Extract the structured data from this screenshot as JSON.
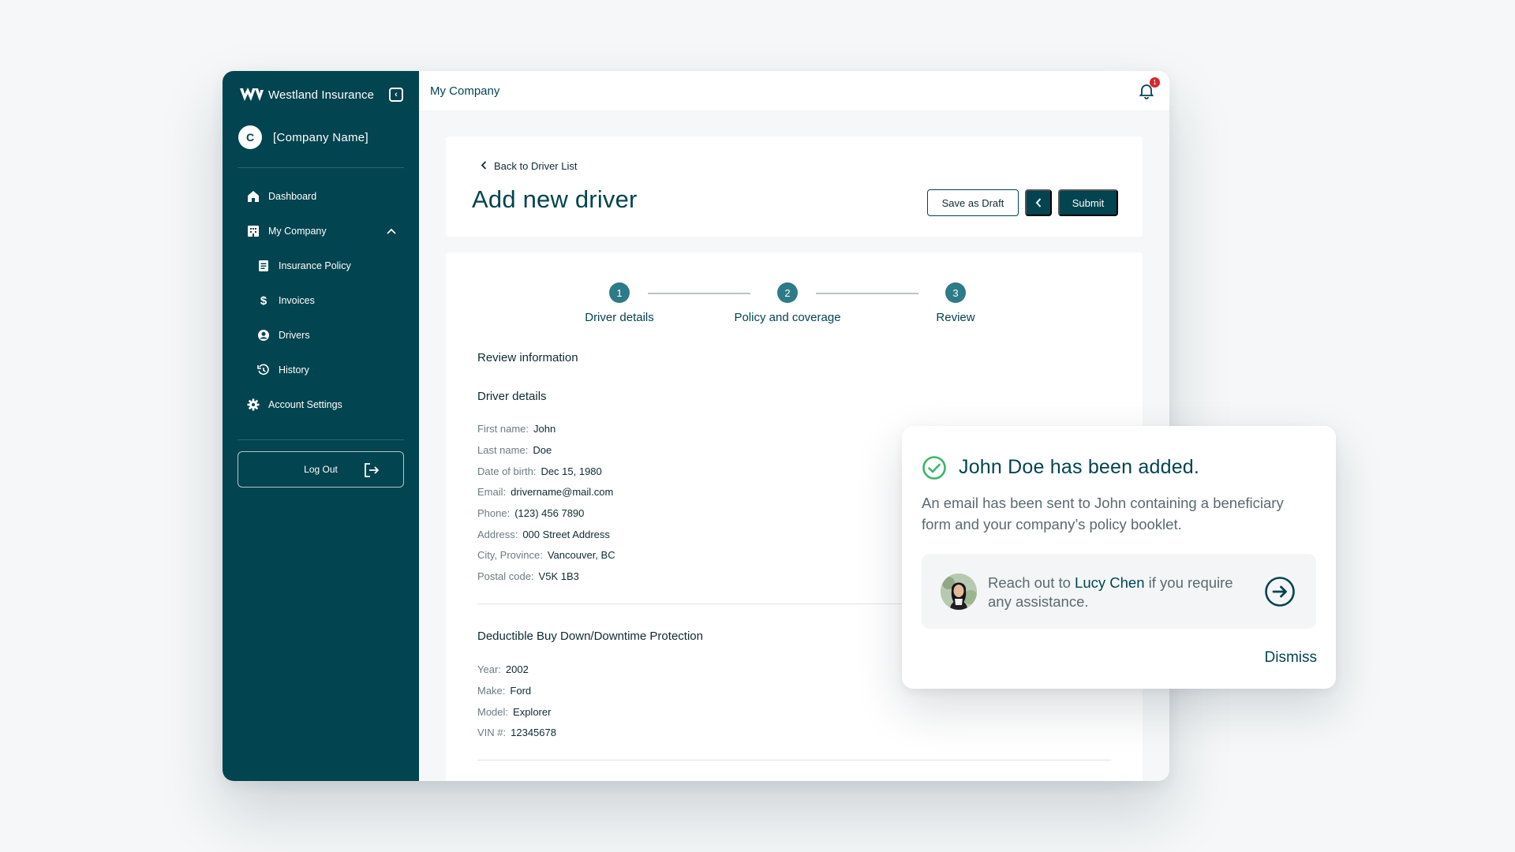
{
  "brand": {
    "name": "Westland Insurance",
    "initial": "W"
  },
  "company": {
    "avatar_letter": "C",
    "name": "[Company Name]"
  },
  "sidebar": {
    "items": [
      {
        "label": "Dashboard"
      },
      {
        "label": "My Company"
      },
      {
        "label": "Insurance Policy"
      },
      {
        "label": "Invoices"
      },
      {
        "label": "Drivers"
      },
      {
        "label": "History"
      },
      {
        "label": "Account Settings"
      }
    ],
    "logout_label": "Log Out"
  },
  "topbar": {
    "title": "My Company",
    "notification_count": "1"
  },
  "header": {
    "back_label": "Back to Driver List",
    "title": "Add new driver",
    "save_draft_label": "Save as Draft",
    "submit_label": "Submit"
  },
  "stepper": {
    "steps": [
      {
        "number": "1",
        "label": "Driver details"
      },
      {
        "number": "2",
        "label": "Policy and coverage"
      },
      {
        "number": "3",
        "label": "Review"
      }
    ]
  },
  "review": {
    "title": "Review information",
    "driver": {
      "title": "Driver details",
      "fields": [
        {
          "key": "First name:",
          "value": "John"
        },
        {
          "key": "Last name:",
          "value": "Doe"
        },
        {
          "key": "Date of birth:",
          "value": "Dec 15, 1980"
        },
        {
          "key": "Email:",
          "value": "drivername@mail.com"
        },
        {
          "key": "Phone:",
          "value": "(123) 456 7890"
        },
        {
          "key": "Address:",
          "value": "000 Street Address"
        },
        {
          "key": "City, Province:",
          "value": "Vancouver, BC"
        },
        {
          "key": "Postal code:",
          "value": "V5K 1B3"
        }
      ]
    },
    "vehicle": {
      "title": "Deductible Buy Down/Downtime Protection",
      "fields": [
        {
          "key": "Year:",
          "value": "2002"
        },
        {
          "key": "Make:",
          "value": "Ford"
        },
        {
          "key": "Model:",
          "value": "Explorer"
        },
        {
          "key": "VIN #:",
          "value": "12345678"
        }
      ]
    }
  },
  "toast": {
    "title": "John Doe has been added.",
    "body": "An email has been sent to John containing a beneficiary form and your company’s policy booklet.",
    "contact_prefix": "Reach out to ",
    "contact_name": "Lucy Chen",
    "contact_suffix": " if you require any assistance.",
    "dismiss_label": "Dismiss"
  },
  "colors": {
    "primary": "#02444f",
    "step": "#2c7b86",
    "success": "#3bb56a",
    "badge": "#d5262c"
  }
}
